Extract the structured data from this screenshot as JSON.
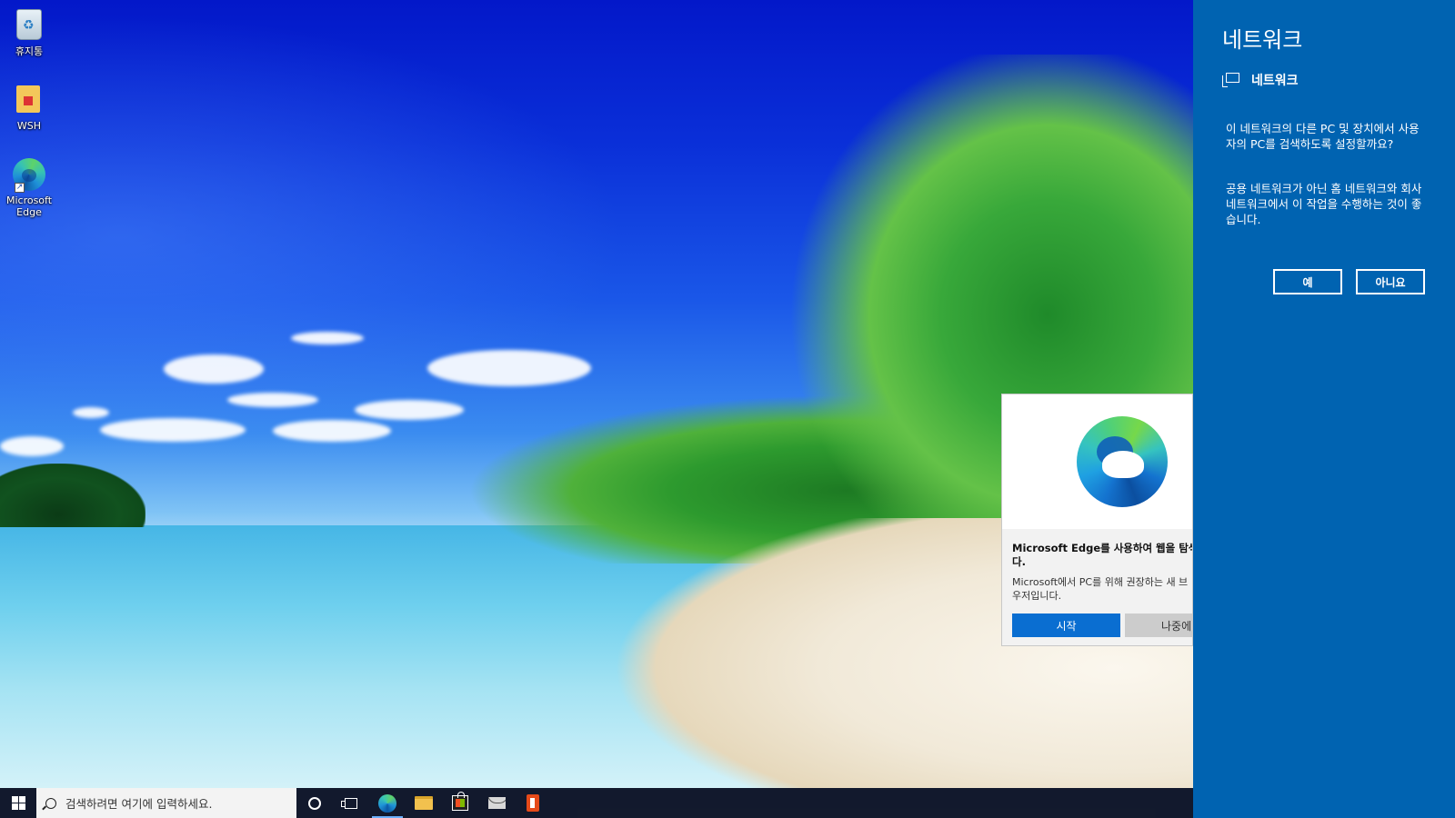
{
  "desktop": {
    "icons": [
      {
        "label": "휴지통",
        "icon": "recycle-bin-icon"
      },
      {
        "label": "WSH",
        "icon": "folder-icon"
      },
      {
        "label": "Microsoft Edge",
        "icon": "edge-icon"
      }
    ]
  },
  "network_panel": {
    "title": "네트워크",
    "network_name": "네트워크",
    "question": "이 네트워크의 다른 PC 및 장치에서 사용자의 PC를 검색하도록 설정할까요?",
    "note": "공용 네트워크가 아닌 홈 네트워크와 회사 네트워크에서 이 작업을 수행하는 것이 좋습니다.",
    "yes_label": "예",
    "no_label": "아니요",
    "background_color": "#0063b1"
  },
  "edge_promo": {
    "heading_line1": "Microsoft  Edge를 사용하여 웹을 탐색",
    "heading_line2": "다.",
    "body_line1": "Microsoft에서 PC를 위해 권장하는 새 브",
    "body_line2": "우저입니다.",
    "start_label": "시작",
    "later_label": "나중에",
    "accent_color": "#0a6ed1"
  },
  "taskbar": {
    "search_placeholder": "검색하려면 여기에 입력하세요.",
    "pinned": [
      "cortana-icon",
      "task-view-icon",
      "edge-icon",
      "file-explorer-icon",
      "store-icon",
      "mail-icon",
      "office-icon"
    ]
  }
}
